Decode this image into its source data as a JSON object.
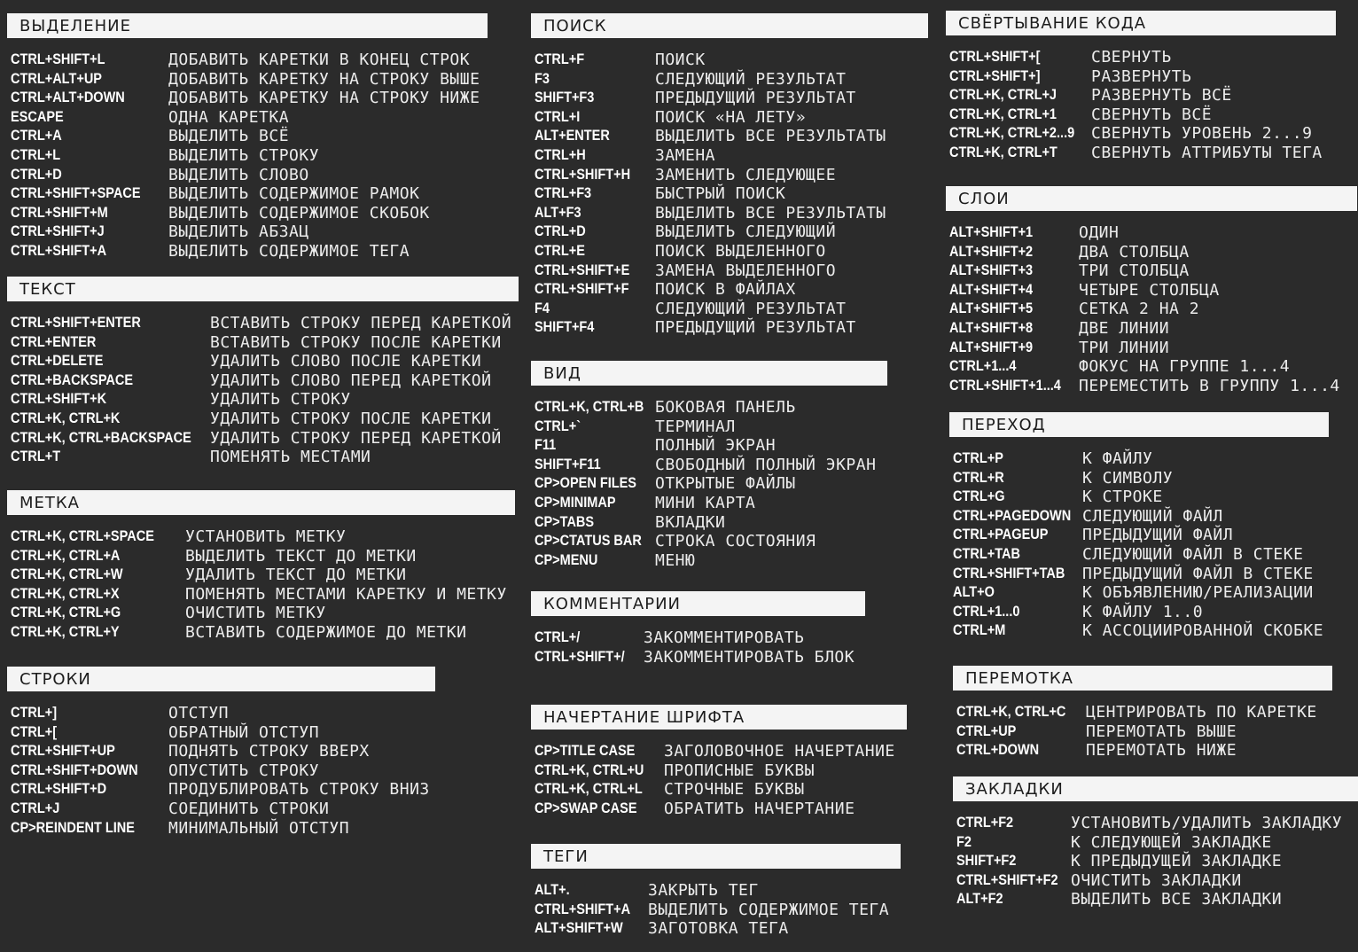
{
  "sections": {
    "selection": {
      "title": "ВЫДЕЛЕНИЕ",
      "rows": [
        {
          "key": "CTRL+SHIFT+L",
          "desc": "ДОБАВИТЬ КАРЕТКИ В КОНЕЦ СТРОК"
        },
        {
          "key": "CTRL+ALT+UP",
          "desc": "ДОБАВИТЬ КАРЕТКУ НА СТРОКУ ВЫШЕ"
        },
        {
          "key": "CTRL+ALT+DOWN",
          "desc": "ДОБАВИТЬ КАРЕТКУ НА СТРОКУ НИЖЕ"
        },
        {
          "key": "ESCAPE",
          "desc": "ОДНА КАРЕТКА"
        },
        {
          "key": "CTRL+A",
          "desc": "ВЫДЕЛИТЬ ВСЁ"
        },
        {
          "key": "CTRL+L",
          "desc": "ВЫДЕЛИТЬ СТРОКУ"
        },
        {
          "key": "CTRL+D",
          "desc": "ВЫДЕЛИТЬ СЛОВО"
        },
        {
          "key": "CTRL+SHIFT+SPACE",
          "desc": "ВЫДЕЛИТЬ СОДЕРЖИМОЕ РАМОК"
        },
        {
          "key": "CTRL+SHIFT+M",
          "desc": "ВЫДЕЛИТЬ СОДЕРЖИМОЕ СКОБОК"
        },
        {
          "key": "CTRL+SHIFT+J",
          "desc": "ВЫДЕЛИТЬ АБЗАЦ"
        },
        {
          "key": "CTRL+SHIFT+A",
          "desc": "ВЫДЕЛИТЬ СОДЕРЖИМОЕ ТЕГА"
        }
      ]
    },
    "text": {
      "title": "ТЕКСТ",
      "rows": [
        {
          "key": "CTRL+SHIFT+ENTER",
          "desc": "ВСТАВИТЬ СТРОКУ ПЕРЕД КАРЕТКОЙ"
        },
        {
          "key": "CTRL+ENTER",
          "desc": "ВСТАВИТЬ СТРОКУ ПОСЛЕ КАРЕТКИ"
        },
        {
          "key": "CTRL+DELETE",
          "desc": "УДАЛИТЬ СЛОВО ПОСЛЕ КАРЕТКИ"
        },
        {
          "key": "CTRL+BACKSPACE",
          "desc": "УДАЛИТЬ СЛОВО ПЕРЕД КАРЕТКОЙ"
        },
        {
          "key": "CTRL+SHIFT+K",
          "desc": "УДАЛИТЬ СТРОКУ"
        },
        {
          "key": "CTRL+K, CTRL+K",
          "desc": "УДАЛИТЬ СТРОКУ ПОСЛЕ КАРЕТКИ"
        },
        {
          "key": "CTRL+K, CTRL+BACKSPACE",
          "desc": "УДАЛИТЬ СТРОКУ ПЕРЕД КАРЕТКОЙ"
        },
        {
          "key": "CTRL+T",
          "desc": "ПОМЕНЯТЬ МЕСТАМИ"
        }
      ]
    },
    "mark": {
      "title": "МЕТКА",
      "rows": [
        {
          "key": "CTRL+K, CTRL+SPACE",
          "desc": "УСТАНОВИТЬ МЕТКУ"
        },
        {
          "key": "CTRL+K, CTRL+A",
          "desc": "ВЫДЕЛИТЬ ТЕКСТ ДО МЕТКИ"
        },
        {
          "key": "CTRL+K, CTRL+W",
          "desc": "УДАЛИТЬ ТЕКСТ ДО МЕТКИ"
        },
        {
          "key": "CTRL+K, CTRL+X",
          "desc": "ПОМЕНЯТЬ МЕСТАМИ КАРЕТКУ И МЕТКУ"
        },
        {
          "key": "CTRL+K, CTRL+G",
          "desc": "ОЧИСТИТЬ МЕТКУ"
        },
        {
          "key": "CTRL+K, CTRL+Y",
          "desc": "ВСТАВИТЬ СОДЕРЖИМОЕ ДО МЕТКИ"
        }
      ]
    },
    "lines": {
      "title": "СТРОКИ",
      "rows": [
        {
          "key": "CTRL+]",
          "desc": "ОТСТУП"
        },
        {
          "key": "CTRL+[",
          "desc": "ОБРАТНЫЙ ОТСТУП"
        },
        {
          "key": "CTRL+SHIFT+UP",
          "desc": "ПОДНЯТЬ СТРОКУ ВВЕРХ"
        },
        {
          "key": "CTRL+SHIFT+DOWN",
          "desc": "ОПУСТИТЬ СТРОКУ"
        },
        {
          "key": "CTRL+SHIFT+D",
          "desc": "ПРОДУБЛИРОВАТЬ СТРОКУ ВНИЗ"
        },
        {
          "key": "CTRL+J",
          "desc": "СОЕДИНИТЬ СТРОКИ"
        },
        {
          "key": "CP>REINDENT LINE",
          "desc": "МИНИМАЛЬНЫЙ ОТСТУП"
        }
      ]
    },
    "search": {
      "title": "ПОИСК",
      "rows": [
        {
          "key": "CTRL+F",
          "desc": "ПОИСК"
        },
        {
          "key": "F3",
          "desc": "СЛЕДУЮЩИЙ РЕЗУЛЬТАТ"
        },
        {
          "key": "SHIFT+F3",
          "desc": "ПРЕДЫДУЩИЙ РЕЗУЛЬТАТ"
        },
        {
          "key": "CTRL+I",
          "desc": "ПОИСК «НА ЛЕТУ»"
        },
        {
          "key": "ALT+ENTER",
          "desc": "ВЫДЕЛИТЬ ВСЕ РЕЗУЛЬТАТЫ"
        },
        {
          "key": "CTRL+H",
          "desc": "ЗАМЕНА"
        },
        {
          "key": "CTRL+SHIFT+H",
          "desc": "ЗАМЕНИТЬ СЛЕДУЮЩЕЕ"
        },
        {
          "key": "CTRL+F3",
          "desc": "БЫСТРЫЙ ПОИСК"
        },
        {
          "key": "ALT+F3",
          "desc": "ВЫДЕЛИТЬ ВСЕ РЕЗУЛЬТАТЫ"
        },
        {
          "key": "CTRL+D",
          "desc": "ВЫДЕЛИТЬ СЛЕДУЮЩИЙ"
        },
        {
          "key": "CTRL+E",
          "desc": "ПОИСК ВЫДЕЛЕННОГО"
        },
        {
          "key": "CTRL+SHIFT+E",
          "desc": "ЗАМЕНА ВЫДЕЛЕННОГО"
        },
        {
          "key": "CTRL+SHIFT+F",
          "desc": "ПОИСК В ФАЙЛАХ"
        },
        {
          "key": "F4",
          "desc": "СЛЕДУЮЩИЙ РЕЗУЛЬТАТ"
        },
        {
          "key": "SHIFT+F4",
          "desc": "ПРЕДЫДУЩИЙ РЕЗУЛЬТАТ"
        }
      ]
    },
    "view": {
      "title": "ВИД",
      "rows": [
        {
          "key": "CTRL+K, CTRL+B",
          "desc": "БОКОВАЯ ПАНЕЛЬ"
        },
        {
          "key": "CTRL+`",
          "desc": "ТЕРМИНАЛ"
        },
        {
          "key": "F11",
          "desc": "ПОЛНЫЙ ЭКРАН"
        },
        {
          "key": "SHIFT+F11",
          "desc": "СВОБОДНЫЙ ПОЛНЫЙ ЭКРАН"
        },
        {
          "key": "CP>OPEN FILES",
          "desc": "ОТКРЫТЫЕ ФАЙЛЫ"
        },
        {
          "key": "CP>MINIMAP",
          "desc": "МИНИ КАРТА"
        },
        {
          "key": "CP>TABS",
          "desc": "ВКЛАДКИ"
        },
        {
          "key": "CP>CTATUS BAR",
          "desc": "СТРОКА СОСТОЯНИЯ"
        },
        {
          "key": "CP>MENU",
          "desc": "МЕНЮ"
        }
      ]
    },
    "comments": {
      "title": "КОММЕНТАРИИ",
      "rows": [
        {
          "key": "CTRL+/",
          "desc": "ЗАКОММЕНТИРОВАТЬ"
        },
        {
          "key": "CTRL+SHIFT+/",
          "desc": "ЗАКОММЕНТИРОВАТЬ БЛОК"
        }
      ]
    },
    "font_case": {
      "title": "НАЧЕРТАНИЕ ШРИФТА",
      "rows": [
        {
          "key": "CP>TITLE CASE",
          "desc": "ЗАГОЛОВОЧНОЕ НАЧЕРТАНИЕ"
        },
        {
          "key": "CTRL+K, CTRL+U",
          "desc": "ПРОПИСНЫЕ БУКВЫ"
        },
        {
          "key": "CTRL+K, CTRL+L",
          "desc": "СТРОЧНЫЕ БУКВЫ"
        },
        {
          "key": "CP>SWAP CASE",
          "desc": "ОБРАТИТЬ НАЧЕРТАНИЕ"
        }
      ]
    },
    "tags": {
      "title": "ТЕГИ",
      "rows": [
        {
          "key": "ALT+.",
          "desc": "ЗАКРЫТЬ ТЕГ"
        },
        {
          "key": "CTRL+SHIFT+A",
          "desc": "ВЫДЕЛИТЬ СОДЕРЖИМОЕ ТЕГА"
        },
        {
          "key": "ALT+SHIFT+W",
          "desc": "ЗАГОТОВКА ТЕГА"
        }
      ]
    },
    "folding": {
      "title": "СВЁРТЫВАНИЕ КОДА",
      "rows": [
        {
          "key": "CTRL+SHIFT+[",
          "desc": "СВЕРНУТЬ"
        },
        {
          "key": "CTRL+SHIFT+]",
          "desc": "РАЗВЕРНУТЬ"
        },
        {
          "key": "CTRL+K, CTRL+J",
          "desc": "РАЗВЕРНУТЬ ВСЁ"
        },
        {
          "key": "CTRL+K, CTRL+1",
          "desc": "СВЕРНУТЬ ВСЁ"
        },
        {
          "key": "CTRL+K, CTRL+2...9",
          "desc": "СВЕРНУТЬ УРОВЕНЬ 2...9"
        },
        {
          "key": "CTRL+K, CTRL+T",
          "desc": "СВЕРНУТЬ АТТРИБУТЫ ТЕГА"
        }
      ]
    },
    "layers": {
      "title": "СЛОИ",
      "rows": [
        {
          "key": "ALT+SHIFT+1",
          "desc": "ОДИН"
        },
        {
          "key": "ALT+SHIFT+2",
          "desc": "ДВА СТОЛБЦА"
        },
        {
          "key": "ALT+SHIFT+3",
          "desc": "ТРИ СТОЛБЦА"
        },
        {
          "key": "ALT+SHIFT+4",
          "desc": "ЧЕТЫРЕ СТОЛБЦА"
        },
        {
          "key": "ALT+SHIFT+5",
          "desc": "СЕТКА 2 НА 2"
        },
        {
          "key": "ALT+SHIFT+8",
          "desc": "ДВЕ ЛИНИИ"
        },
        {
          "key": "ALT+SHIFT+9",
          "desc": "ТРИ ЛИНИИ"
        },
        {
          "key": "CTRL+1...4",
          "desc": "ФОКУС НА ГРУППЕ 1...4"
        },
        {
          "key": "CTRL+SHIFT+1...4",
          "desc": "ПЕРЕМЕСТИТЬ В ГРУППУ 1...4"
        }
      ]
    },
    "navigation": {
      "title": "ПЕРЕХОД",
      "rows": [
        {
          "key": "CTRL+P",
          "desc": "К ФАЙЛУ"
        },
        {
          "key": "CTRL+R",
          "desc": "К СИМВОЛУ"
        },
        {
          "key": "CTRL+G",
          "desc": "К СТРОКЕ"
        },
        {
          "key": "CTRL+PAGEDOWN",
          "desc": "СЛЕДУЮЩИЙ ФАЙЛ"
        },
        {
          "key": "CTRL+PAGEUP",
          "desc": "ПРЕДЫДУЩИЙ ФАЙЛ"
        },
        {
          "key": "CTRL+TAB",
          "desc": "СЛЕДУЮЩИЙ ФАЙЛ В СТЕКЕ"
        },
        {
          "key": "CTRL+SHIFT+TAB",
          "desc": "ПРЕДЫДУЩИЙ ФАЙЛ В СТЕКЕ"
        },
        {
          "key": "ALT+O",
          "desc": "К ОБЪЯВЛЕНИЮ/РЕАЛИЗАЦИИ"
        },
        {
          "key": "CTRL+1...0",
          "desc": "К ФАЙЛУ 1..0"
        },
        {
          "key": "CTRL+M",
          "desc": "К АССОЦИИРОВАННОЙ СКОБКЕ"
        }
      ]
    },
    "scrolling": {
      "title": "ПЕРЕМОТКА",
      "rows": [
        {
          "key": "CTRL+K, CTRL+C",
          "desc": "ЦЕНТРИРОВАТЬ ПО КАРЕТКЕ"
        },
        {
          "key": "CTRL+UP",
          "desc": "ПЕРЕМОТАТЬ ВЫШЕ"
        },
        {
          "key": "CTRL+DOWN",
          "desc": "ПЕРЕМОТАТЬ НИЖЕ"
        }
      ]
    },
    "bookmarks": {
      "title": "ЗАКЛАДКИ",
      "rows": [
        {
          "key": "CTRL+F2",
          "desc": "УСТАНОВИТЬ/УДАЛИТЬ ЗАКЛАДКУ"
        },
        {
          "key": "F2",
          "desc": "К СЛЕДУЮЩЕЙ ЗАКЛАДКЕ"
        },
        {
          "key": "SHIFT+F2",
          "desc": "К ПРЕДЫДУЩЕЙ ЗАКЛАДКЕ"
        },
        {
          "key": "CTRL+SHIFT+F2",
          "desc": "ОЧИСТИТЬ ЗАКЛАДКИ"
        },
        {
          "key": "ALT+F2",
          "desc": "ВЫДЕЛИТЬ ВСЕ ЗАКЛАДКИ"
        }
      ]
    }
  }
}
